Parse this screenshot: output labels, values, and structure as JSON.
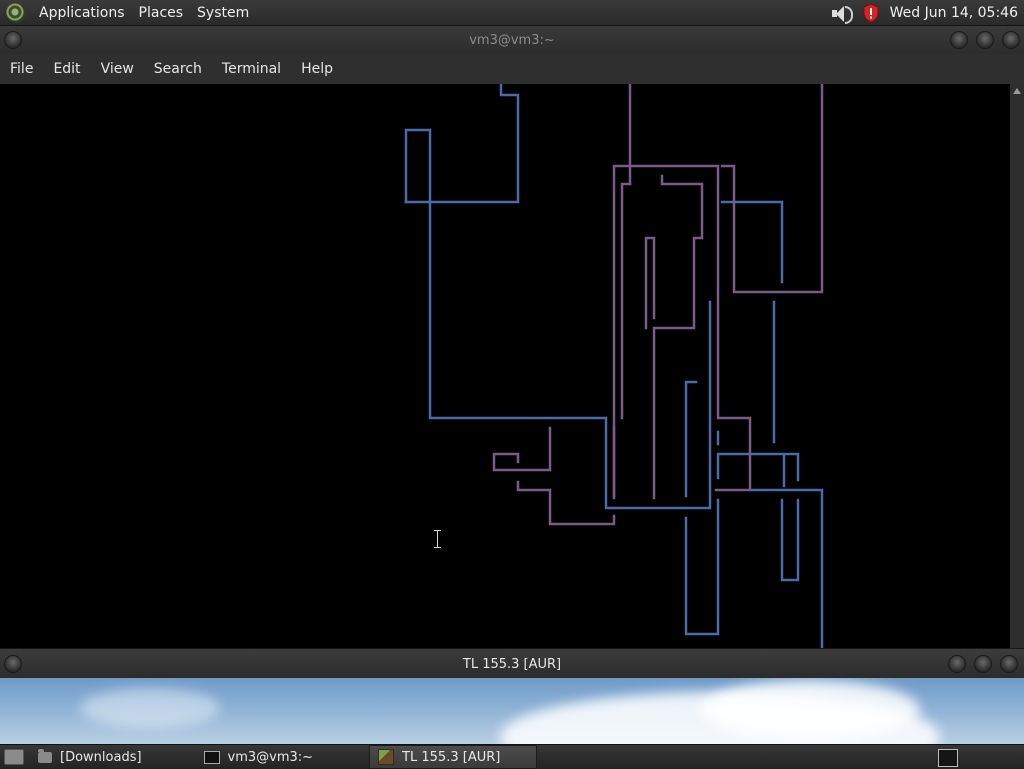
{
  "top_panel": {
    "menus": [
      "Applications",
      "Places",
      "System"
    ],
    "clock": "Wed Jun 14, 05:46"
  },
  "terminal": {
    "title": "vm3@vm3:~",
    "menu": [
      "File",
      "Edit",
      "View",
      "Search",
      "Terminal",
      "Help"
    ]
  },
  "second_window": {
    "title": "TL 155.3 [AUR]"
  },
  "taskbar": {
    "tasks": [
      "[Downloads]",
      "vm3@vm3:~",
      "TL 155.3 [AUR]"
    ]
  },
  "colors": {
    "pipe_blue": "#4a6aa8",
    "pipe_purple": "#7a5a86",
    "terminal_bg": "#000000"
  }
}
